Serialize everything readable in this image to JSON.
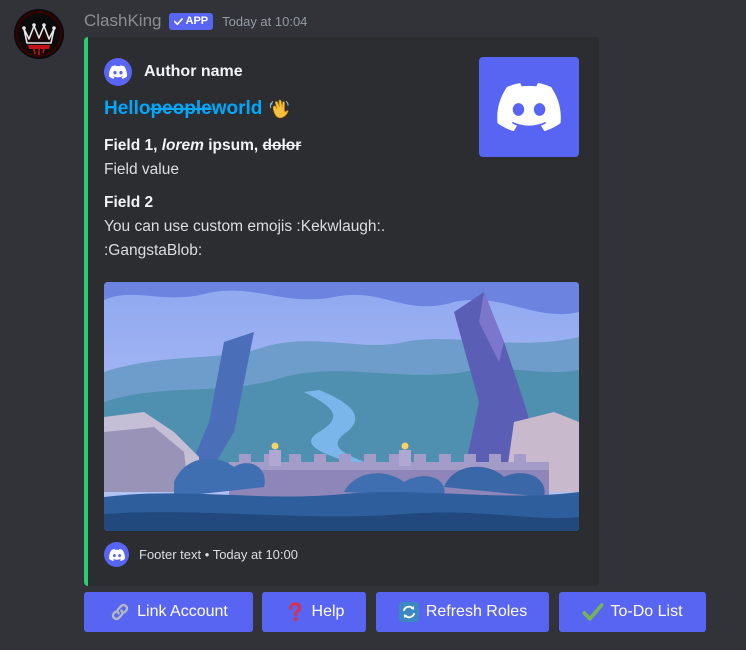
{
  "message": {
    "username": "ClashKing",
    "app_tag": "APP",
    "timestamp": "Today at 10:04"
  },
  "embed": {
    "accent_color": "#2ecc71",
    "author_name": "Author name",
    "title": {
      "part1": "Hello ",
      "part2": "people",
      "part3": " world"
    },
    "fields": [
      {
        "name": {
          "part1": "Field 1, ",
          "part2": "lorem",
          "part3": " ipsum, ",
          "part4": "dolor"
        },
        "value": "Field value"
      },
      {
        "name": "Field 2",
        "value_line1": "You can use custom emojis :Kekwlaugh:.",
        "value_line2": ":GangstaBlob:"
      }
    ],
    "footer": {
      "text": "Footer text",
      "separator": " • ",
      "timestamp": "Today at 10:00"
    }
  },
  "buttons": [
    {
      "label": "Link Account",
      "icon": "link-icon"
    },
    {
      "label": "Help",
      "icon": "question-mark-icon"
    },
    {
      "label": "Refresh Roles",
      "icon": "refresh-icon"
    },
    {
      "label": "To-Do List",
      "icon": "check-mark-icon"
    }
  ],
  "colors": {
    "background": "#313338",
    "embed_background": "#2b2d31",
    "blurple": "#5865f2",
    "link_blue": "#00a8fc"
  }
}
